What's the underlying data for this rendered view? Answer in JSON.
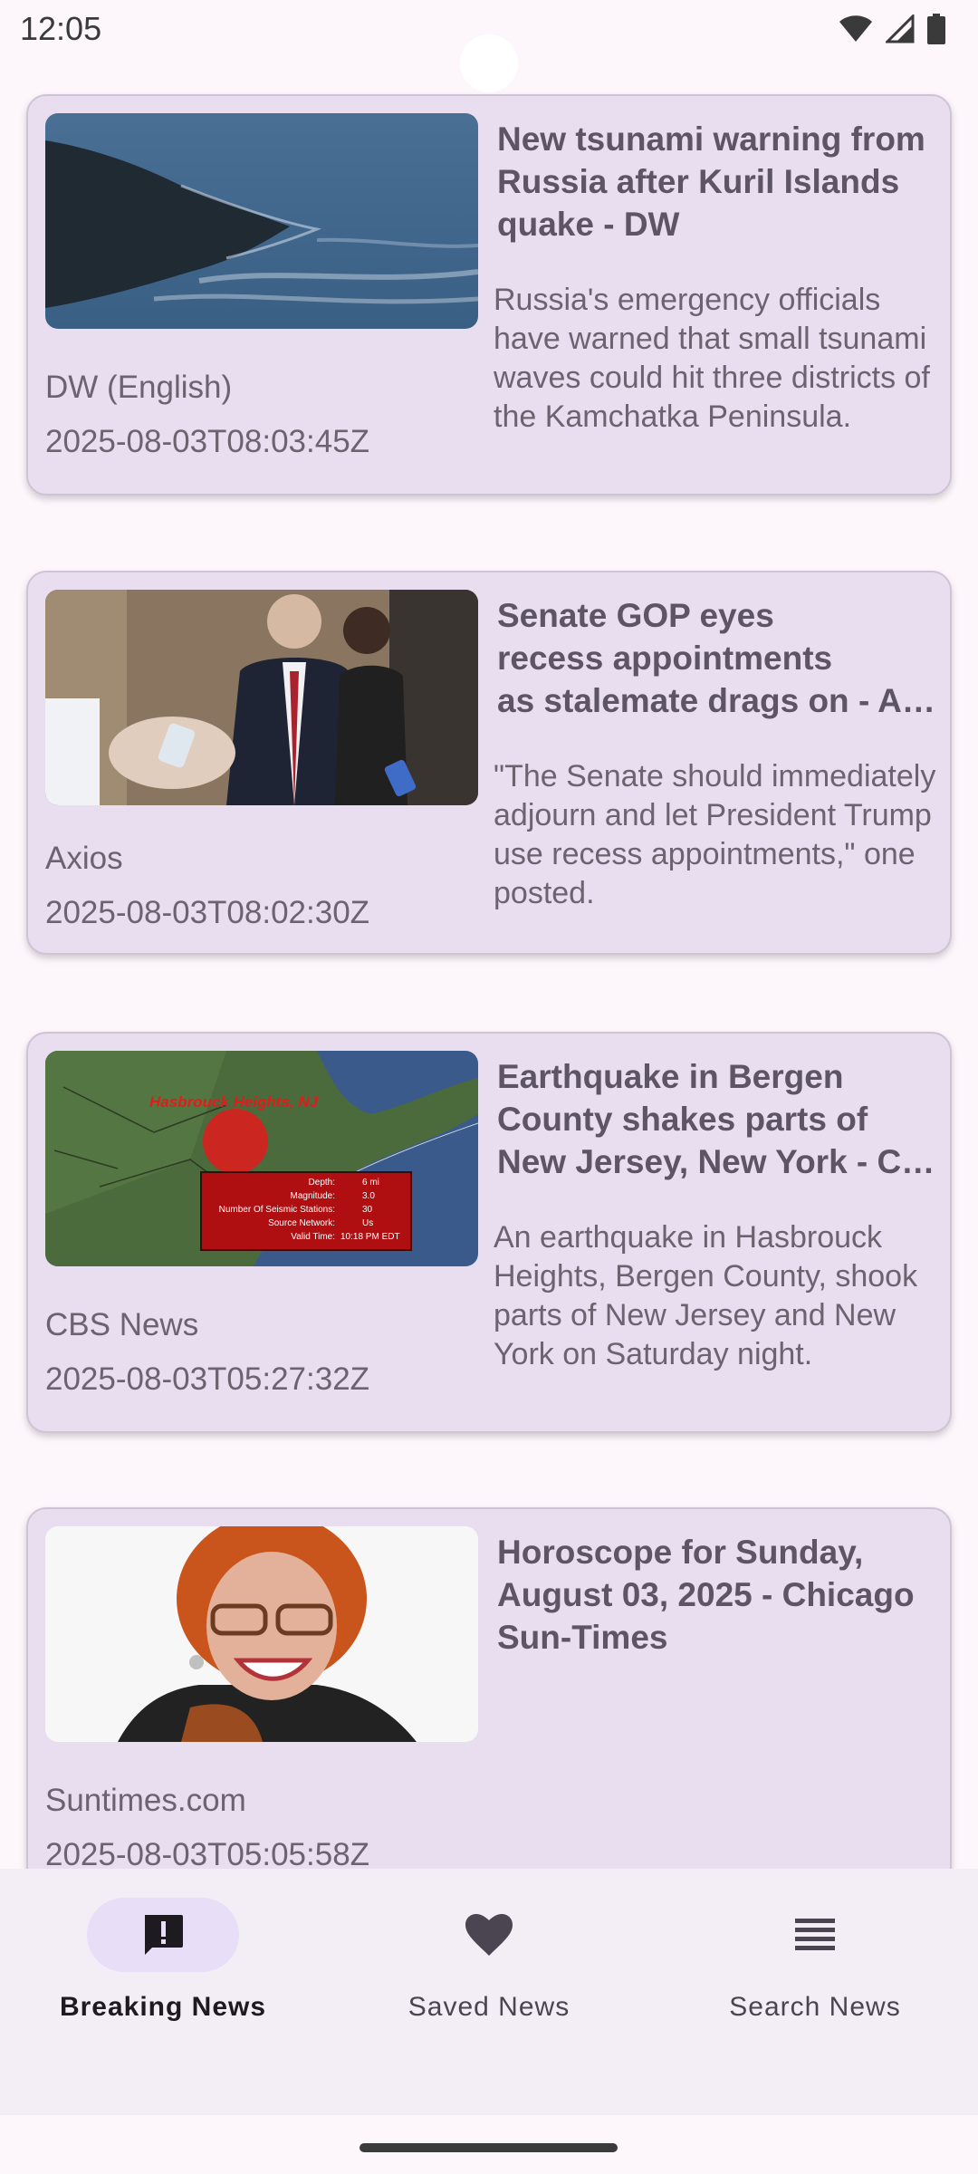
{
  "status_bar": {
    "time": "12:05",
    "icons": [
      "wifi-icon",
      "cell-signal-icon",
      "battery-icon"
    ]
  },
  "articles": [
    {
      "title": "New tsunami warning from Russia after Kuril Islands quake - DW",
      "description": "Russia's emergency officials have warned that small tsunami waves could hit three districts of the Kamchatka Peninsula.",
      "source": "DW (English)",
      "published_at": "2025-08-03T08:03:45Z",
      "image": "coastline-photo"
    },
    {
      "title": "Senate GOP eyes recess appointments as stalemate drags on - Axios",
      "description": "\"The Senate should immediately adjourn and let President Trump use recess appointments,\" one posted.",
      "source": "Axios",
      "published_at": "2025-08-03T08:02:30Z",
      "image": "senators-hallway-photo"
    },
    {
      "title": "Earthquake in Bergen County shakes parts of New Jersey, New York - CBS News",
      "description": "An earthquake in Hasbrouck Heights, Bergen County, shook parts of New Jersey and New York on Saturday night.",
      "source": "CBS News",
      "published_at": "2025-08-03T05:27:32Z",
      "image": "earthquake-map",
      "image_text": {
        "location": "Hasbrouck Heights, NJ",
        "depth_label": "Depth:",
        "depth_value": "6 mi",
        "magnitude_label": "Magnitude:",
        "magnitude_value": "3.0",
        "stations_label": "Number Of Seismic Stations:",
        "stations_value": "30",
        "network_label": "Source Network:",
        "network_value": "Us",
        "time_label": "Valid Time:",
        "time_value": "10:18 PM EDT"
      }
    },
    {
      "title": "Horoscope for Sunday, August 03, 2025 - Chicago Sun-Times",
      "description": "",
      "source": "Suntimes.com",
      "published_at": "2025-08-03T05:05:58Z",
      "image": "smiling-woman-photo"
    }
  ],
  "bottom_nav": {
    "items": [
      {
        "label": "Breaking News",
        "icon": "feedback-alert-icon",
        "active": true
      },
      {
        "label": "Saved News",
        "icon": "heart-icon",
        "active": false
      },
      {
        "label": "Search News",
        "icon": "list-lines-icon",
        "active": false
      }
    ]
  },
  "colors": {
    "card_bg": "#e9def0",
    "nav_bg": "#f3edf6",
    "active_indicator": "#e8def8",
    "title_text": "#5d5565"
  }
}
